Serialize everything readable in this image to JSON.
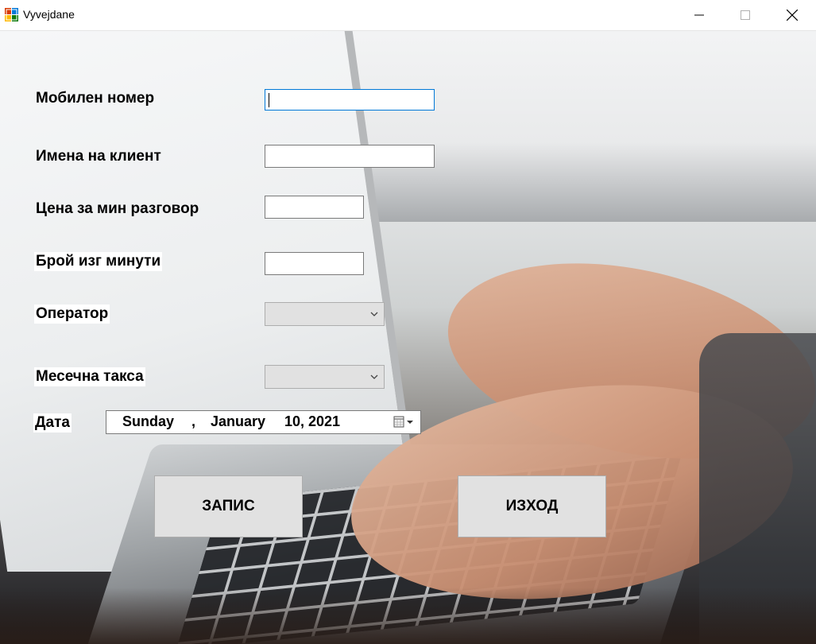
{
  "window": {
    "title": "Vyvejdane",
    "controls": [
      "minimize",
      "maximize",
      "close"
    ]
  },
  "form": {
    "mobile_label": "Мобилен номер",
    "mobile_value": "",
    "client_label": "Имена на клиент",
    "client_value": "",
    "price_label": "Цена за мин разговор",
    "price_value": "",
    "minutes_label": "Брой изг минути",
    "minutes_value": "",
    "operator_label": "Оператор",
    "operator_value": "",
    "fee_label": "Месечна такса",
    "fee_value": "",
    "date_label": "Дата",
    "date": {
      "weekday": "Sunday",
      "sep": ",",
      "month": "January",
      "day_year": "10, 2021"
    }
  },
  "buttons": {
    "save_label": "ЗАПИС",
    "exit_label": "ИЗХОД"
  },
  "colors": {
    "focus_border": "#0078d7",
    "button_bg": "#e1e1e1",
    "combo_bg": "#e1e1e1"
  },
  "icons": {
    "app": "app-icon",
    "calendar": "calendar-icon",
    "dropdown": "chevron-down-icon"
  }
}
